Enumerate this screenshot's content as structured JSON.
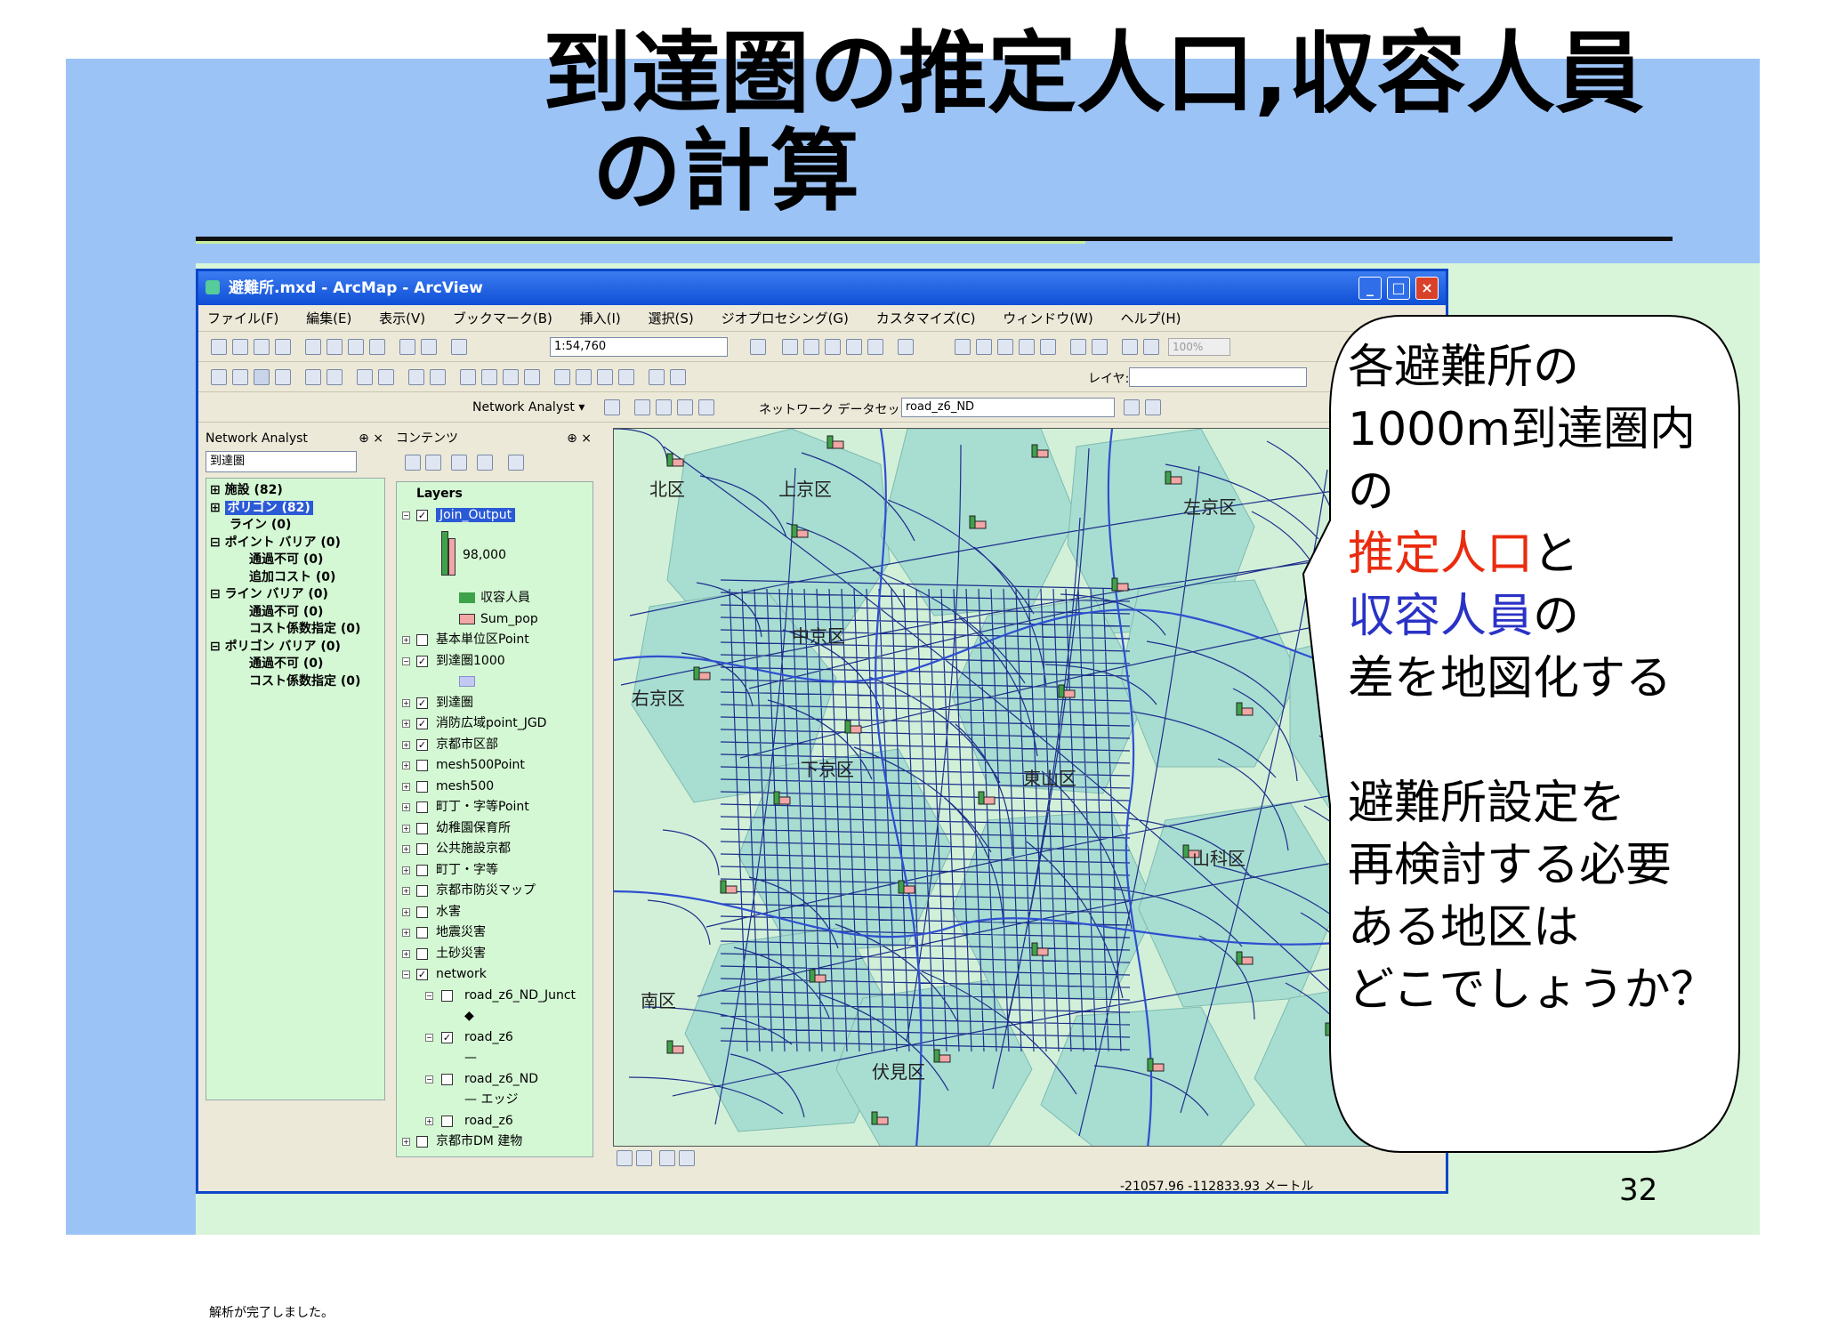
{
  "slide": {
    "title_line1": "到達圏の推定人口,収容人員",
    "title_line2": "の計算",
    "page_number": "32",
    "background_color": "#d9f5d9",
    "accent_color": "#9cc3f5"
  },
  "window": {
    "title": "避難所.mxd - ArcMap - ArcView",
    "menu": [
      "ファイル(F)",
      "編集(E)",
      "表示(V)",
      "ブックマーク(B)",
      "挿入(I)",
      "選択(S)",
      "ジオプロセシング(G)",
      "カスタマイズ(C)",
      "ウィンドウ(W)",
      "ヘルプ(H)"
    ],
    "scale_value": "1:54,760",
    "layer_label": "レイヤ:",
    "network_analyst_label": "Network Analyst ▾",
    "network_dataset_label": "ネットワーク データセット",
    "network_dataset_value": "road_z6_ND",
    "zoom_value": "100%"
  },
  "na_panel": {
    "title": "Network Analyst",
    "dropdown": "到達圏",
    "tree": [
      {
        "text": "施設 (82)",
        "indent": 0
      },
      {
        "text": "ポリゴン (82)",
        "indent": 0,
        "selected": true
      },
      {
        "text": "ライン (0)",
        "indent": 1
      },
      {
        "text": "ポイント バリア (0)",
        "indent": 0
      },
      {
        "text": "通過不可 (0)",
        "indent": 2
      },
      {
        "text": "追加コスト (0)",
        "indent": 2
      },
      {
        "text": "ライン バリア (0)",
        "indent": 0
      },
      {
        "text": "通過不可 (0)",
        "indent": 2
      },
      {
        "text": "コスト係数指定 (0)",
        "indent": 2
      },
      {
        "text": "ポリゴン バリア (0)",
        "indent": 0
      },
      {
        "text": "通過不可 (0)",
        "indent": 2
      },
      {
        "text": "コスト係数指定 (0)",
        "indent": 2
      }
    ],
    "status": "解析が完了しました。"
  },
  "toc": {
    "title": "コンテンツ",
    "root": "Layers",
    "join_output": "Join_Output",
    "chart_value": "98,000",
    "legend": [
      {
        "label": "収容人員",
        "color": "#3ea24a"
      },
      {
        "label": "Sum_pop",
        "color": "#f2a6a6"
      }
    ],
    "layers": [
      {
        "name": "基本単位区Point",
        "checked": false
      },
      {
        "name": "到達圏1000",
        "checked": true
      },
      {
        "name": "到達圏",
        "checked": true
      },
      {
        "name": "消防広域point_JGD",
        "checked": true
      },
      {
        "name": "京都市区部",
        "checked": true
      },
      {
        "name": "mesh500Point",
        "checked": false
      },
      {
        "name": "mesh500",
        "checked": false
      },
      {
        "name": "町丁・字等Point",
        "checked": false
      },
      {
        "name": "幼稚園保育所",
        "checked": false
      },
      {
        "name": "公共施設京都",
        "checked": false
      },
      {
        "name": "町丁・字等",
        "checked": false
      },
      {
        "name": "京都市防災マップ",
        "checked": false
      },
      {
        "name": "水害",
        "checked": false
      },
      {
        "name": "地震災害",
        "checked": false
      },
      {
        "name": "土砂災害",
        "checked": false
      },
      {
        "name": "network",
        "checked": true
      }
    ],
    "sublayers": [
      {
        "name": "road_z6_ND_Junct",
        "checked": false
      },
      {
        "name": "road_z6",
        "checked": true
      },
      {
        "name": "road_z6_ND",
        "checked": false
      },
      {
        "name": "エッジ",
        "checked": null
      },
      {
        "name": "road_z6",
        "checked": false
      }
    ],
    "last_partial": "京都市DM 建物"
  },
  "map": {
    "ward_labels": [
      "北区",
      "上京区",
      "左京区",
      "中京区",
      "右京区",
      "下京区",
      "東山区",
      "山科区",
      "南区",
      "伏見区"
    ],
    "coordinates": "-21057.96  -112833.93 メートル",
    "colors": {
      "map_bg": "#d2f0d8",
      "polygon": "#a8ddd2",
      "road": "#1c2f8a",
      "boundary": "#2e4fcf"
    }
  },
  "callout": {
    "line1": "各避難所の",
    "line2": "1000m到達圏内",
    "line3": "の",
    "line4_red": "推定人口",
    "line4_rest": "と",
    "line5_blue": "収容人員",
    "line5_rest": "の",
    "line6": "差を地図化する",
    "line7": "避難所設定を",
    "line8": "再検討する必要",
    "line9": "ある地区は",
    "line10": "どこでしょうか？",
    "red": "#ea2b0e",
    "blue": "#2a32c6"
  }
}
